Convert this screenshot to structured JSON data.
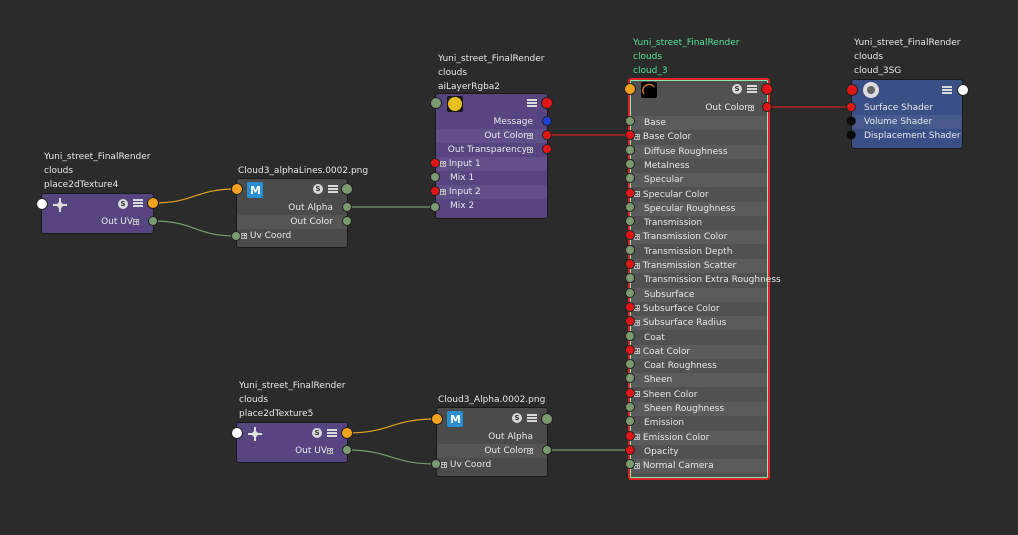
{
  "n_place4": {
    "l1": "Yuni_street_FinalRender",
    "l2": "clouds",
    "l3": "place2dTexture4",
    "out_uv": "Out UV"
  },
  "n_alphaLines": {
    "title": "Cloud3_alphaLines.0002.png",
    "out_alpha": "Out Alpha",
    "out_color": "Out Color",
    "uv_coord": "Uv Coord"
  },
  "n_layer": {
    "l1": "Yuni_street_FinalRender",
    "l2": "clouds",
    "l3": "aiLayerRgba2",
    "message": "Message",
    "out_color": "Out Color",
    "out_transparency": "Out Transparency",
    "input1": "Input 1",
    "mix1": "Mix 1",
    "input2": "Input 2",
    "mix2": "Mix 2"
  },
  "n_shader": {
    "l1": "Yuni_street_FinalRender",
    "l2": "clouds",
    "l3": "cloud_3",
    "out_color": "Out Color",
    "attrs": [
      "Base",
      "Base Color",
      "Diffuse Roughness",
      "Metalness",
      "Specular",
      "Specular Color",
      "Specular Roughness",
      "Transmission",
      "Transmission Color",
      "Transmission Depth",
      "Transmission Scatter",
      "Transmission Extra Roughness",
      "Subsurface",
      "Subsurface Color",
      "Subsurface Radius",
      "Coat",
      "Coat Color",
      "Coat Roughness",
      "Sheen",
      "Sheen Color",
      "Sheen Roughness",
      "Emission",
      "Emission Color",
      "Opacity",
      "Normal Camera"
    ]
  },
  "n_sg": {
    "l1": "Yuni_street_FinalRender",
    "l2": "clouds",
    "l3": "cloud_3SG",
    "surface": "Surface Shader",
    "volume": "Volume Shader",
    "displacement": "Displacement Shader"
  },
  "n_place5": {
    "l1": "Yuni_street_FinalRender",
    "l2": "clouds",
    "l3": "place2dTexture5",
    "out_uv": "Out UV"
  },
  "n_alpha": {
    "title": "Cloud3_Alpha.0002.png",
    "out_alpha": "Out Alpha",
    "out_color": "Out Color",
    "uv_coord": "Uv Coord"
  },
  "icons": {
    "swatch": "s-icon",
    "menu": "menu-icon",
    "file": "file-texture-icon",
    "place2d": "place2d-icon",
    "shader": "shader-swatch-icon"
  },
  "colors": {
    "bg": "#2b2b2b",
    "wire_color": "#cc2020",
    "wire_float": "#7a9a70",
    "wire_uv": "#7a9a70",
    "wire_orange": "#f2a21d",
    "selected": "#55e39a"
  }
}
